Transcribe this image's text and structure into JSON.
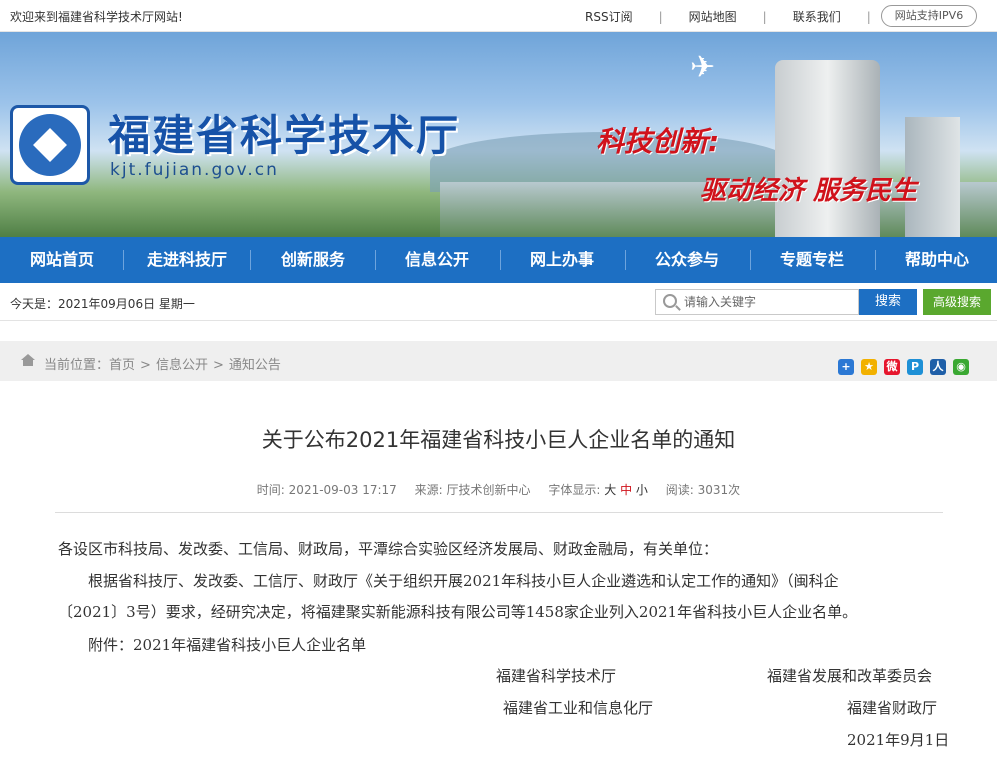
{
  "topbar": {
    "welcome": "欢迎来到福建省科学技术厅网站!",
    "rss": "RSS订阅",
    "sitemap": "网站地图",
    "contact": "联系我们",
    "ipv6": "网站支持IPV6"
  },
  "banner": {
    "title": "福建省科学技术厅",
    "domain": "kjt.fujian.gov.cn",
    "slogan_line1": "科技创新:",
    "slogan_line2": "驱动经济 服务民生"
  },
  "nav": {
    "items": [
      {
        "label": "网站首页"
      },
      {
        "label": "走进科技厅"
      },
      {
        "label": "创新服务"
      },
      {
        "label": "信息公开"
      },
      {
        "label": "网上办事"
      },
      {
        "label": "公众参与"
      },
      {
        "label": "专题专栏"
      },
      {
        "label": "帮助中心"
      }
    ]
  },
  "datebar": {
    "date_text": "今天是：2021年09月06日  星期一",
    "search_placeholder": "请输入关键字",
    "search_button": "搜索",
    "advanced_button": "高级搜索"
  },
  "breadcrumb": {
    "prefix": "当前位置：",
    "items": [
      "首页",
      "信息公开",
      "通知公告"
    ],
    "separator": ">"
  },
  "share_icons": [
    {
      "icon": "plus-icon",
      "color": "#2b78d4",
      "glyph": "+"
    },
    {
      "icon": "qzone-icon",
      "color": "#f2b100",
      "glyph": "★"
    },
    {
      "icon": "weibo-icon",
      "color": "#e6162d",
      "glyph": "微"
    },
    {
      "icon": "tencent-weibo-icon",
      "color": "#1e90d6",
      "glyph": "P"
    },
    {
      "icon": "renren-icon",
      "color": "#1f5fa8",
      "glyph": "人"
    },
    {
      "icon": "wechat-icon",
      "color": "#3aa832",
      "glyph": "◉"
    }
  ],
  "article": {
    "title": "关于公布2021年福建省科技小巨人企业名单的通知",
    "time_label": "时间:",
    "time_value": "2021-09-03 17:17",
    "source_label": "来源:",
    "source_value": "厅技术创新中心",
    "font_label": "字体显示:",
    "font_big": "大",
    "font_mid": "中",
    "font_small": "小",
    "views_label": "阅读:",
    "views_value": "3031次",
    "salutation": "各设区市科技局、发改委、工信局、财政局，平潭综合实验区经济发展局、财政金融局，有关单位：",
    "para1_line1": "根据省科技厅、发改委、工信厅、财政厅《关于组织开展2021年科技小巨人企业遴选和认定工作的通知》（闽科企",
    "para1_line2": "〔2021〕3号）要求，经研究决定，将福建聚实新能源科技有限公司等1458家企业列入2021年省科技小巨人企业名单。",
    "attachment": "附件：2021年福建省科技小巨人企业名单",
    "signatories": [
      "福建省科学技术厅",
      "福建省发展和改革委员会",
      "福建省工业和信息化厅",
      "福建省财政厅"
    ],
    "sign_date": "2021年9月1日"
  }
}
